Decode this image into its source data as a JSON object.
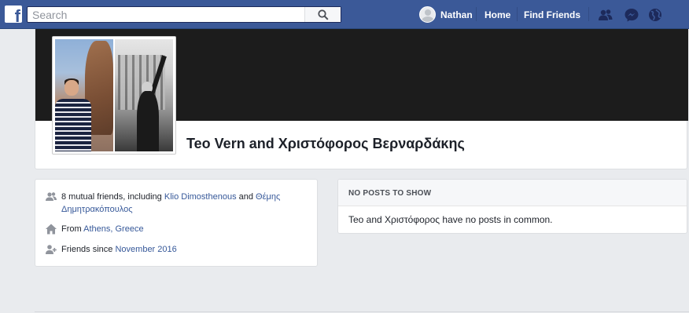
{
  "topbar": {
    "logo": "f",
    "search_placeholder": "Search",
    "user_name": "Nathan",
    "home_label": "Home",
    "find_friends_label": "Find Friends",
    "icons": [
      "friend-requests-icon",
      "messenger-icon",
      "notifications-globe-icon"
    ],
    "brand_color": "#3b5998"
  },
  "profile": {
    "name": "Teo Vern and Χριστόφορος Βερναρδάκης"
  },
  "intro": {
    "mutual_prefix": "8 mutual friends, including ",
    "mutual_friend_1": "Klio Dimosthenous",
    "mutual_and": " and ",
    "mutual_friend_2": "Θέμης Δημητρακόπουλος",
    "from_prefix": "From ",
    "from_location": "Athens, Greece",
    "friends_since_prefix": "Friends since ",
    "friends_since_date": "November 2016"
  },
  "posts": {
    "header": "NO POSTS TO SHOW",
    "message": "Teo and Χριστόφορος have no posts in common."
  },
  "colors": {
    "link": "#365899",
    "background": "#e9ebee"
  }
}
